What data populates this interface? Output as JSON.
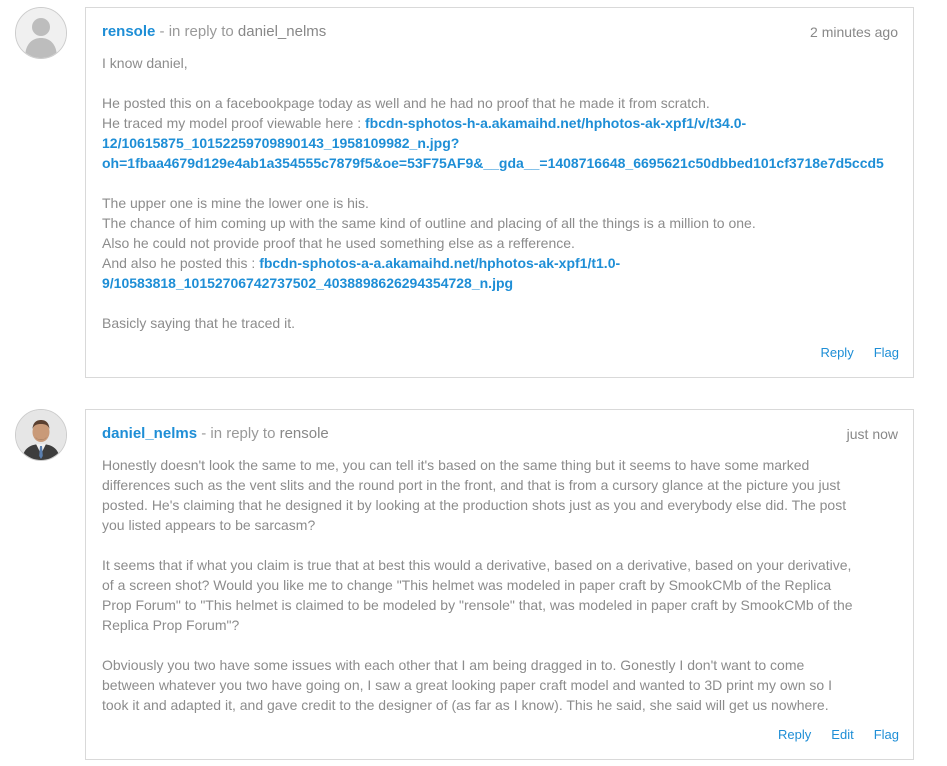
{
  "comments": [
    {
      "author": "rensole",
      "in_reply_to_label": " - in reply to ",
      "parent_author": "daniel_nelms",
      "timestamp": "2 minutes ago",
      "lines": {
        "l0": "I know daniel,",
        "l2": "He posted this on a facebookpage today as well and he had no proof that he made it from scratch.",
        "l3a": "He traced my model proof viewable here : ",
        "l3b": "fbcdn-sphotos-h-a.akamaihd.net/hphotos-ak-xpf1/v/t34.0-",
        "l4": "12/10615875_10152259709890143_1958109982_n.jpg?",
        "l5": "oh=1fbaa4679d129e4ab1a354555c7879f5&oe=53F75AF9&__gda__=1408716648_6695621c50dbbed101cf3718e7d5ccd5",
        "l7": "The upper one is mine the lower one is his.",
        "l8": "The chance of him coming up with the same kind of outline and placing of all the things is a million to one.",
        "l9": "Also he could not provide proof that he used something else as a refference.",
        "l10a": "And also he posted this : ",
        "l10b": "fbcdn-sphotos-a-a.akamaihd.net/hphotos-ak-xpf1/t1.0-",
        "l11": "9/10583818_10152706742737502_4038898626294354728_n.jpg",
        "l13": "Basicly saying that he traced it."
      },
      "actions": {
        "reply": "Reply",
        "flag": "Flag"
      }
    },
    {
      "author": "daniel_nelms",
      "in_reply_to_label": " - in reply to ",
      "parent_author": "rensole",
      "timestamp": "just now",
      "lines": {
        "l0": "Honestly doesn't look the same to me, you can tell it's based on the same thing but it seems to have some marked",
        "l1": "differences such as the vent slits and the round port in the front, and that is from a cursory glance at the picture you just",
        "l2": "posted. He's claiming that he designed it by looking at the production shots just as you and everybody else did. The post",
        "l3": "you listed appears to be sarcasm?",
        "l5": "It seems that if what you claim is true that at best this would a derivative, based on a derivative, based on your derivative,",
        "l6": "of a screen shot? Would you like me to change \"This helmet was modeled in paper craft by SmookCMb of the Replica",
        "l7": "Prop Forum\" to \"This helmet is claimed to be modeled by \"rensole\" that, was modeled in paper craft by SmookCMb of the",
        "l8": "Replica Prop Forum\"?",
        "l10": "Obviously you two have some issues with each other that I am being dragged in to. Gonestly I don't want to come",
        "l11": "between whatever you two have going on, I saw a great looking paper craft model and wanted to 3D print my own so I",
        "l12": "took it and adapted it, and gave credit to the designer of (as far as I know). This he said, she said will get us nowhere."
      },
      "actions": {
        "reply": "Reply",
        "edit": "Edit",
        "flag": "Flag"
      }
    }
  ],
  "colors": {
    "link": "#1e8ed6",
    "text": "#8c8c8c",
    "border": "#d9d9d9"
  },
  "icons": {
    "avatar1": "default-user-silhouette-icon",
    "avatar2": "user-photo-avatar"
  }
}
